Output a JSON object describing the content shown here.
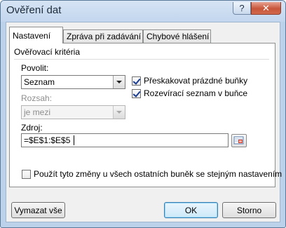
{
  "window": {
    "title": "Ověření dat",
    "help_label": "?",
    "close_label": "✕"
  },
  "tabs": [
    {
      "label": "Nastavení",
      "active": true
    },
    {
      "label": "Zpráva při zadávání",
      "active": false
    },
    {
      "label": "Chybové hlášení",
      "active": false
    }
  ],
  "criteria": {
    "group_title": "Ověřovací kritéria",
    "allow_label": "Povolit:",
    "allow_value": "Seznam",
    "range_label": "Rozsah:",
    "range_value": "je mezi",
    "ignore_blank_label": "Přeskakovat prázdné buňky",
    "ignore_blank_checked": true,
    "in_cell_dropdown_label": "Rozevírací seznam v buňce",
    "in_cell_dropdown_checked": true,
    "source_label": "Zdroj:",
    "source_value": "=$E$1:$E$5"
  },
  "apply_all": {
    "label": "Použít tyto změny u všech ostatních buněk se stejným nastavením",
    "checked": false
  },
  "buttons": {
    "clear_all": "Vymazat vše",
    "ok": "OK",
    "cancel": "Storno"
  },
  "colors": {
    "frame": "#bcd1ea",
    "panel": "#ffffff",
    "check": "#1a3d8f"
  }
}
